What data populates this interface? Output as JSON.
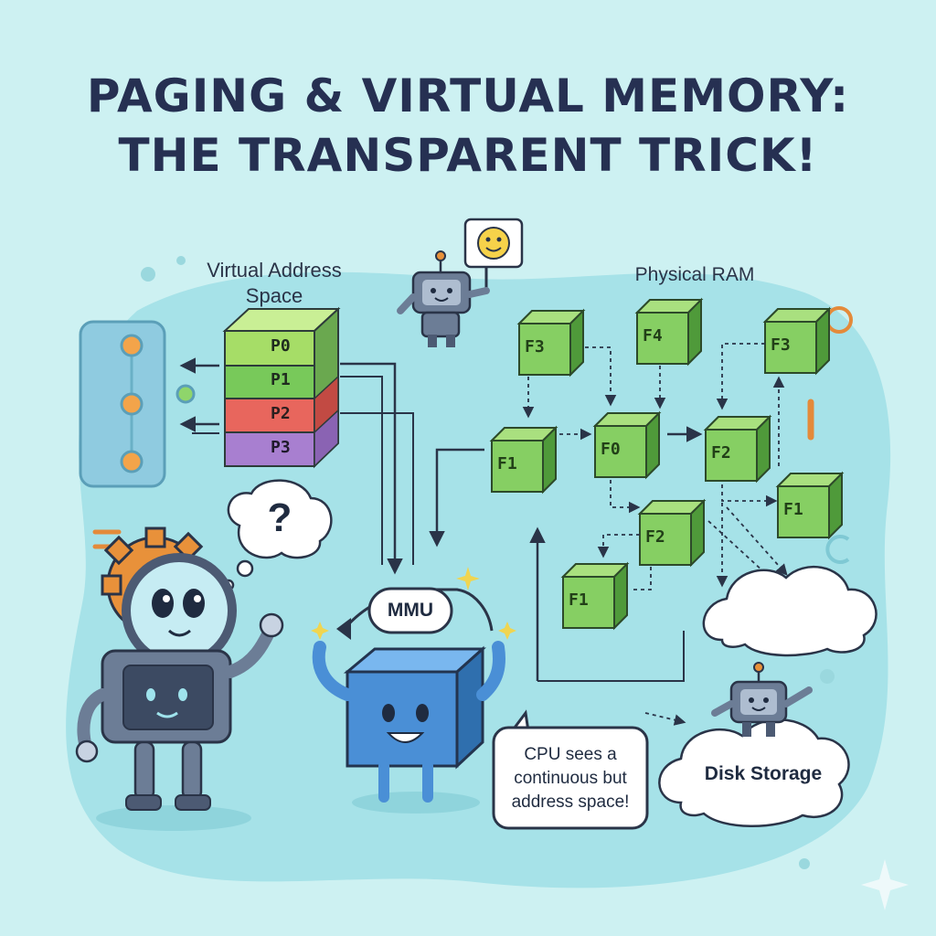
{
  "title": {
    "line1": "PAGING & VIRTUAL MEMORY:",
    "line2": "THE TRANSPARENT TRICK!"
  },
  "labels": {
    "virtual_address": "Virtual Address",
    "space": "Space",
    "physical_ram": "Physical RAM",
    "mmu": "MMU",
    "question_mark": "?",
    "cpu_line1": "CPU sees a",
    "cpu_line2": "continuous but",
    "cpu_line3": "address space!",
    "disk_storage": "Disk Storage"
  },
  "pages": [
    "P0",
    "P1",
    "P2",
    "P3"
  ],
  "frames": [
    "F3",
    "F4",
    "F3",
    "F1",
    "F0",
    "F2",
    "F2",
    "F1",
    "F1"
  ],
  "icons": [
    "smiley-icon",
    "sparkle-icon",
    "gear-icon",
    "magnifier-icon"
  ],
  "colors": {
    "background": "#cdf1f2",
    "blob": "#a6e2e8",
    "frame_green": "#8fd56b",
    "page_p0": "#a6dd67",
    "page_p1": "#78c95a",
    "page_p2": "#e8665d",
    "page_p3": "#a87fd0",
    "mmu_blue": "#4a8fd6",
    "ink": "#263052"
  }
}
